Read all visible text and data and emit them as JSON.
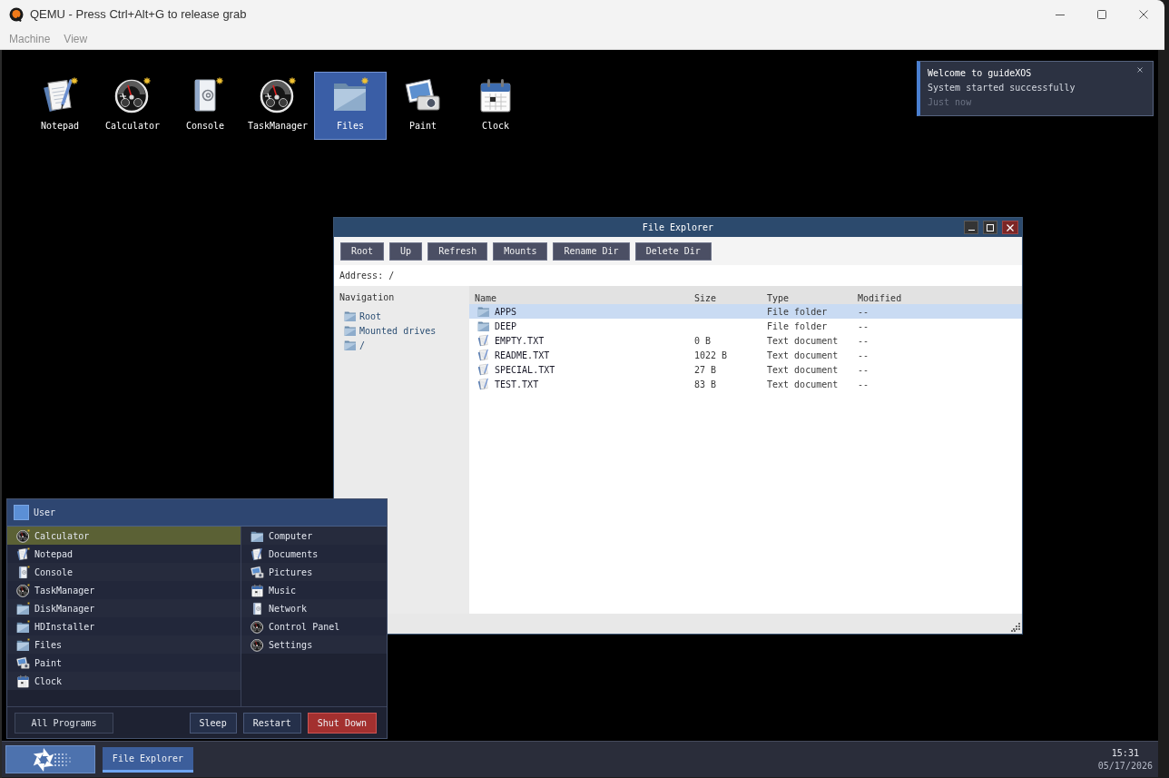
{
  "window": {
    "title": "QEMU - Press Ctrl+Alt+G to release grab",
    "menu": [
      "Machine",
      "View"
    ]
  },
  "desktop_icons": [
    {
      "label": "Notepad",
      "kind": "notepad",
      "starred": true,
      "selected": false
    },
    {
      "label": "Calculator",
      "kind": "dial",
      "starred": true,
      "selected": false
    },
    {
      "label": "Console",
      "kind": "book",
      "starred": true,
      "selected": false
    },
    {
      "label": "TaskManager",
      "kind": "dial",
      "starred": true,
      "selected": false
    },
    {
      "label": "Files",
      "kind": "folder",
      "starred": true,
      "selected": true
    },
    {
      "label": "Paint",
      "kind": "photos",
      "starred": false,
      "selected": false
    },
    {
      "label": "Clock",
      "kind": "calendar",
      "starred": false,
      "selected": false
    }
  ],
  "notification": {
    "title": "Welcome to guideXOS",
    "message": "System started successfully",
    "time": "Just now"
  },
  "file_explorer": {
    "title": "File Explorer",
    "toolbar": [
      "Root",
      "Up",
      "Refresh",
      "Mounts",
      "Rename Dir",
      "Delete Dir"
    ],
    "address": {
      "label": "Address:",
      "value": "/"
    },
    "navigation": {
      "heading": "Navigation",
      "items": [
        "Root",
        "Mounted drives",
        "/"
      ]
    },
    "table": {
      "columns": [
        "Name",
        "Size",
        "Type",
        "Modified"
      ],
      "rows": [
        {
          "kind": "folder",
          "name": "APPS",
          "type": "File folder",
          "modified": "--",
          "selected": true
        },
        {
          "kind": "folder",
          "name": "DEEP",
          "type": "File folder",
          "modified": "--",
          "selected": false
        },
        {
          "kind": "document",
          "name": "EMPTY.TXT",
          "size": "0 B",
          "type": "Text document",
          "modified": "--",
          "selected": false
        },
        {
          "kind": "document",
          "name": "README.TXT",
          "size": "1022 B",
          "type": "Text document",
          "modified": "--",
          "selected": false
        },
        {
          "kind": "document",
          "name": "SPECIAL.TXT",
          "size": "27 B",
          "type": "Text document",
          "modified": "--",
          "selected": false
        },
        {
          "kind": "document",
          "name": "TEST.TXT",
          "size": "83 B",
          "type": "Text document",
          "modified": "--",
          "selected": false
        }
      ]
    }
  },
  "start_menu": {
    "user": "User",
    "programs": [
      {
        "label": "Calculator",
        "kind": "dial",
        "starred": true,
        "selected": true
      },
      {
        "label": "Notepad",
        "kind": "notepad",
        "starred": true,
        "selected": false
      },
      {
        "label": "Console",
        "kind": "book",
        "starred": true,
        "selected": false
      },
      {
        "label": "TaskManager",
        "kind": "dial",
        "starred": true,
        "selected": false
      },
      {
        "label": "DiskManager",
        "kind": "folder",
        "starred": true,
        "selected": false
      },
      {
        "label": "HDInstaller",
        "kind": "folder",
        "starred": true,
        "selected": false
      },
      {
        "label": "Files",
        "kind": "folder",
        "starred": true,
        "selected": false
      },
      {
        "label": "Paint",
        "kind": "photos",
        "starred": false,
        "selected": false
      },
      {
        "label": "Clock",
        "kind": "calendar",
        "starred": false,
        "selected": false
      }
    ],
    "places": [
      {
        "label": "Computer",
        "kind": "folder",
        "selected": false
      },
      {
        "label": "Documents",
        "kind": "notepad",
        "selected": false
      },
      {
        "label": "Pictures",
        "kind": "photos",
        "selected": false
      },
      {
        "label": "Music",
        "kind": "calendar",
        "selected": false
      },
      {
        "label": "Network",
        "kind": "book",
        "selected": false
      },
      {
        "label": "Control Panel",
        "kind": "dial",
        "selected": false
      },
      {
        "label": "Settings",
        "kind": "dial",
        "selected": false
      }
    ],
    "all_programs": "All Programs",
    "power_buttons": [
      {
        "label": "Sleep",
        "kind": "normal"
      },
      {
        "label": "Restart",
        "kind": "normal"
      },
      {
        "label": "Shut Down",
        "kind": "danger"
      }
    ]
  },
  "taskbar": {
    "tasks": [
      {
        "label": "File Explorer",
        "selected": true
      }
    ],
    "time": "15:31",
    "date": "05/17/2026"
  }
}
